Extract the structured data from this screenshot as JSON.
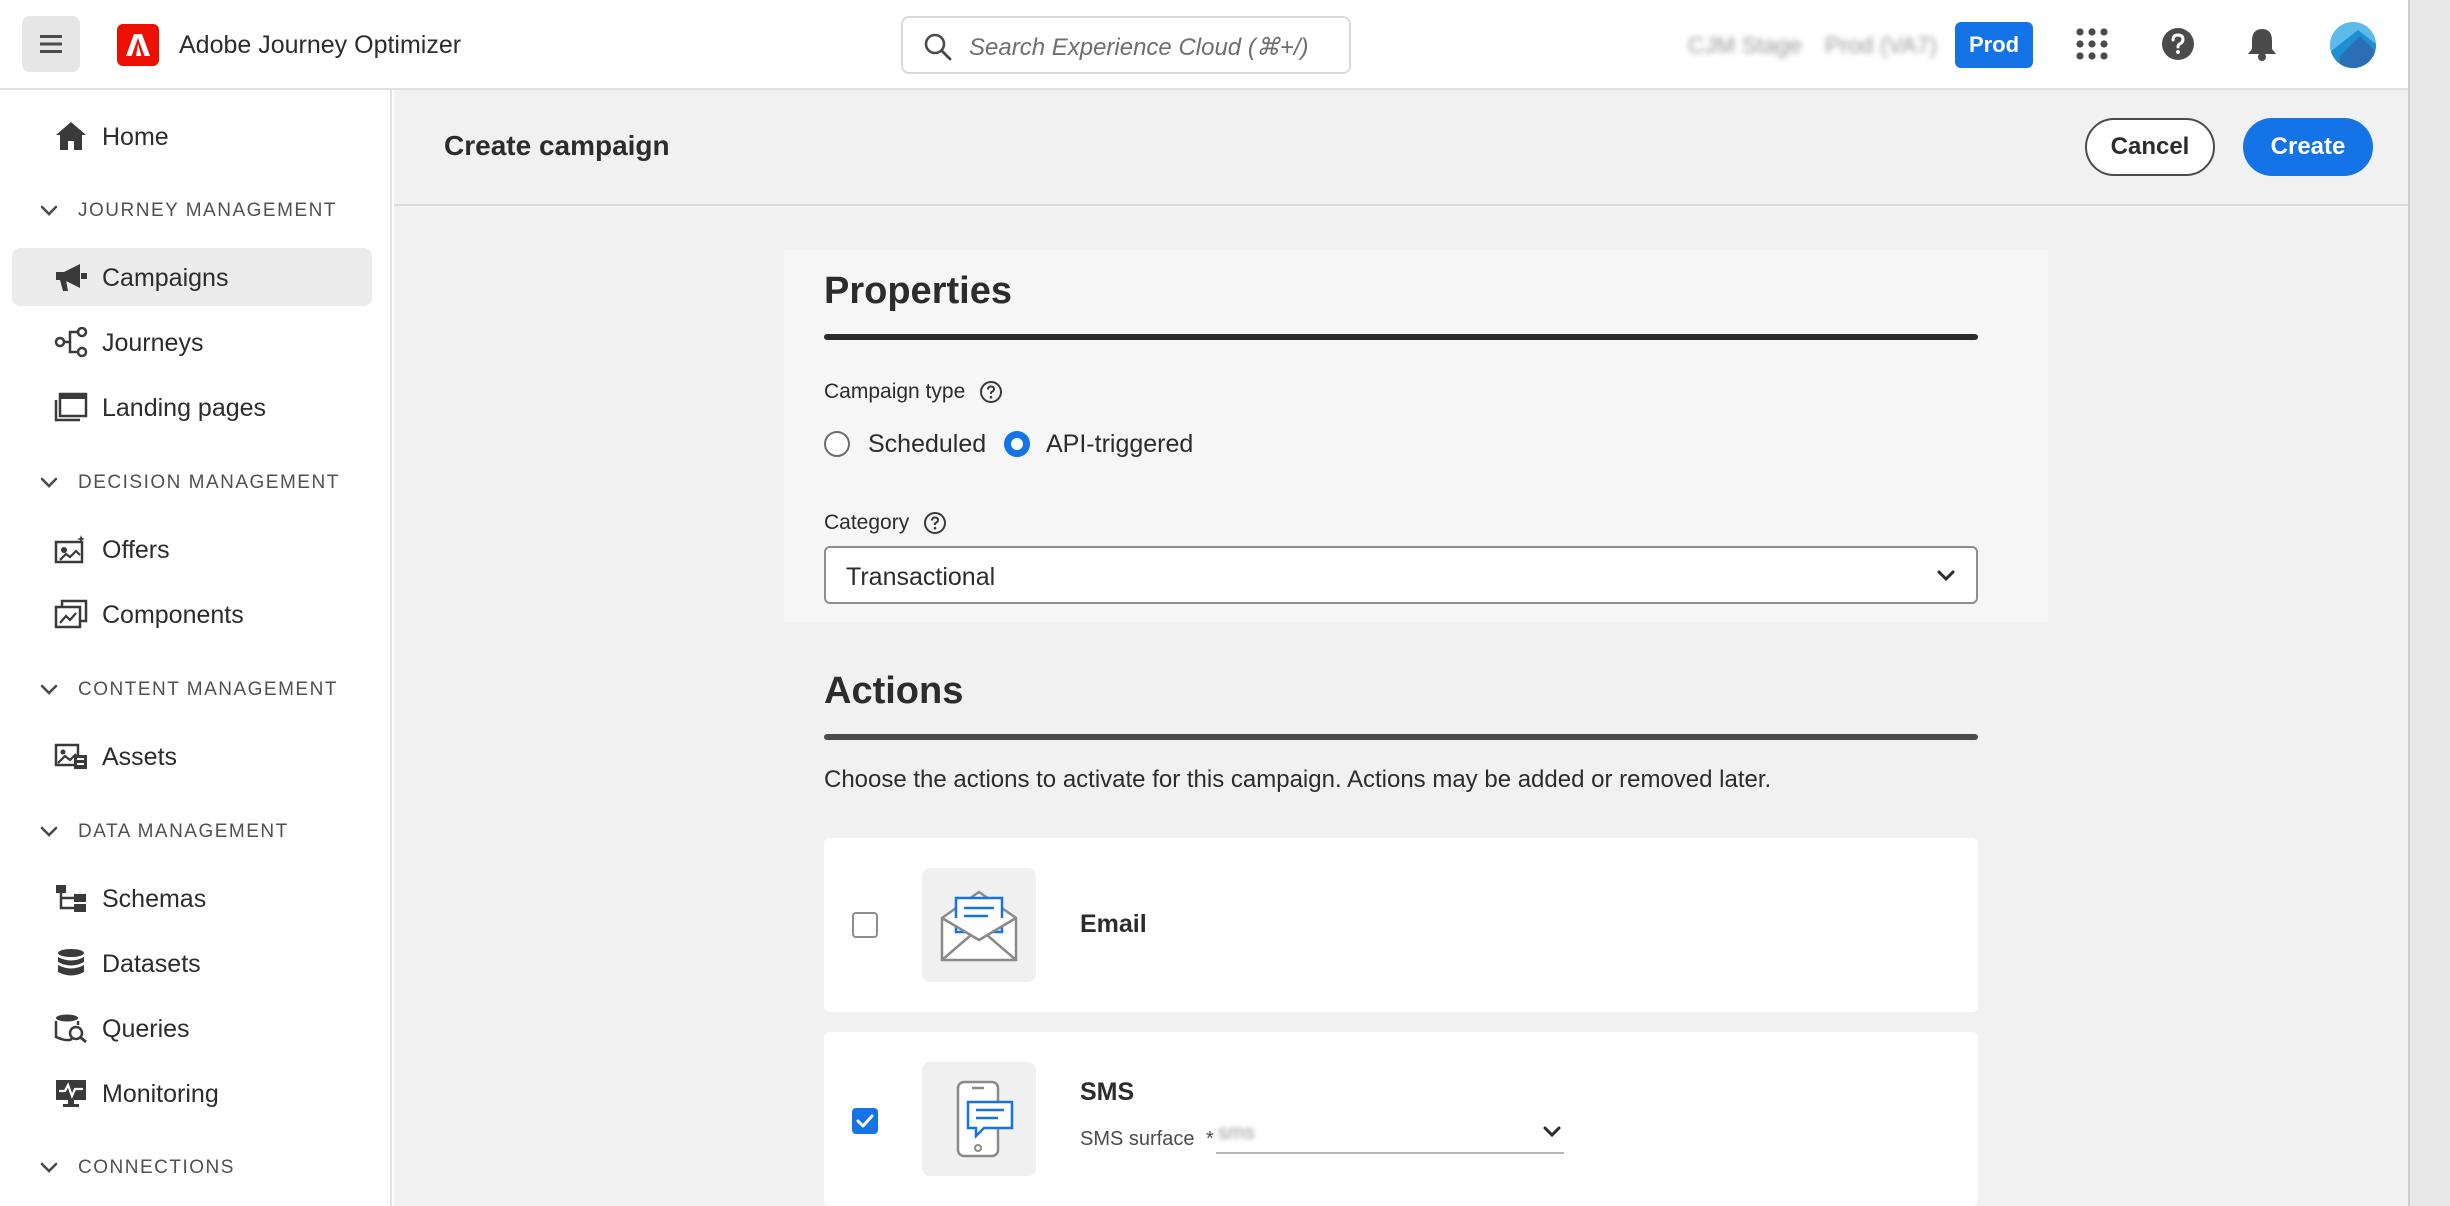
{
  "topbar": {
    "app_title": "Adobe Journey Optimizer",
    "search_placeholder": "Search Experience Cloud (⌘+/)",
    "org_name": "CJM Stage",
    "sandbox_name": "Prod (VA7)",
    "env_badge": "Prod"
  },
  "sidebar": {
    "home": "Home",
    "sections": {
      "journey": "JOURNEY MANAGEMENT",
      "decision": "DECISION MANAGEMENT",
      "content": "CONTENT MANAGEMENT",
      "data": "DATA MANAGEMENT",
      "connections": "CONNECTIONS"
    },
    "items": {
      "campaigns": "Campaigns",
      "journeys": "Journeys",
      "landing_pages": "Landing pages",
      "offers": "Offers",
      "components": "Components",
      "assets": "Assets",
      "schemas": "Schemas",
      "datasets": "Datasets",
      "queries": "Queries",
      "monitoring": "Monitoring"
    },
    "active_item": "Campaigns"
  },
  "page": {
    "title": "Create campaign",
    "cancel_label": "Cancel",
    "create_label": "Create"
  },
  "properties": {
    "title": "Properties",
    "campaign_type_label": "Campaign type",
    "campaign_type_options": [
      "Scheduled",
      "API-triggered"
    ],
    "campaign_type_selected": "API-triggered",
    "category_label": "Category",
    "category_value": "Transactional"
  },
  "actions": {
    "title": "Actions",
    "description": "Choose the actions to activate for this campaign. Actions may be added or removed later.",
    "email": {
      "label": "Email",
      "checked": false
    },
    "sms": {
      "label": "SMS",
      "checked": true,
      "surface_label": "SMS surface",
      "surface_required": "*",
      "surface_value": "sms"
    }
  },
  "colors": {
    "accent": "#1473e6",
    "adobe_red": "#eb1000"
  }
}
